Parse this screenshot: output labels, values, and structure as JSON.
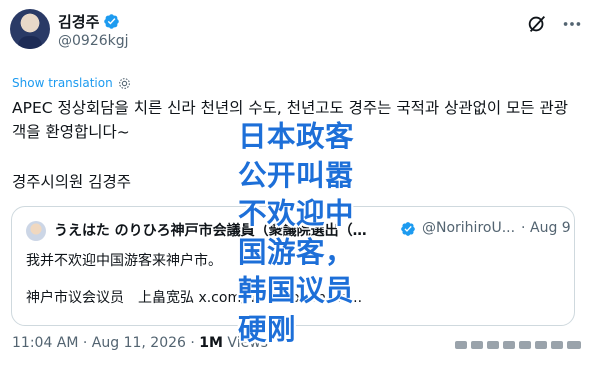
{
  "author": {
    "display_name": "김경주",
    "handle": "@0926kgj"
  },
  "translate_label": "Show translation",
  "post": {
    "text": "APEC 정상회담을 치른 신라 천년의 수도, 천년고도 경주는 국적과 상관없이 모든 관광객을 환영합니다~",
    "signature": "경주시의원 김경주"
  },
  "quoted_post": {
    "author_name": "うえはた のりひろ神戸市会議員（衆議院選出（…",
    "handle": "@NorihiroU...",
    "separator": "·",
    "date": "Aug 9",
    "line1": "我并不欢迎中国游客来神户市。",
    "line2": "神户市议会议员　上畠宽弘 x.com/norihirouehata..."
  },
  "meta": {
    "time": "11:04 AM · Aug 11, 2026 · ",
    "views_count": "1M",
    "views_label": " Views"
  },
  "overlay_caption": {
    "lines": [
      "日本政客",
      "公开叫嚣",
      "不欢迎中",
      "国游客，",
      "韩国议员",
      "硬刚"
    ]
  },
  "colors": {
    "accent": "#1d9bf0",
    "overlay_text": "#1d6fd8"
  },
  "icons": {
    "verified": "verified-badge-icon",
    "grok": "grok-icon",
    "more": "more-icon",
    "translate": "gear-icon"
  }
}
